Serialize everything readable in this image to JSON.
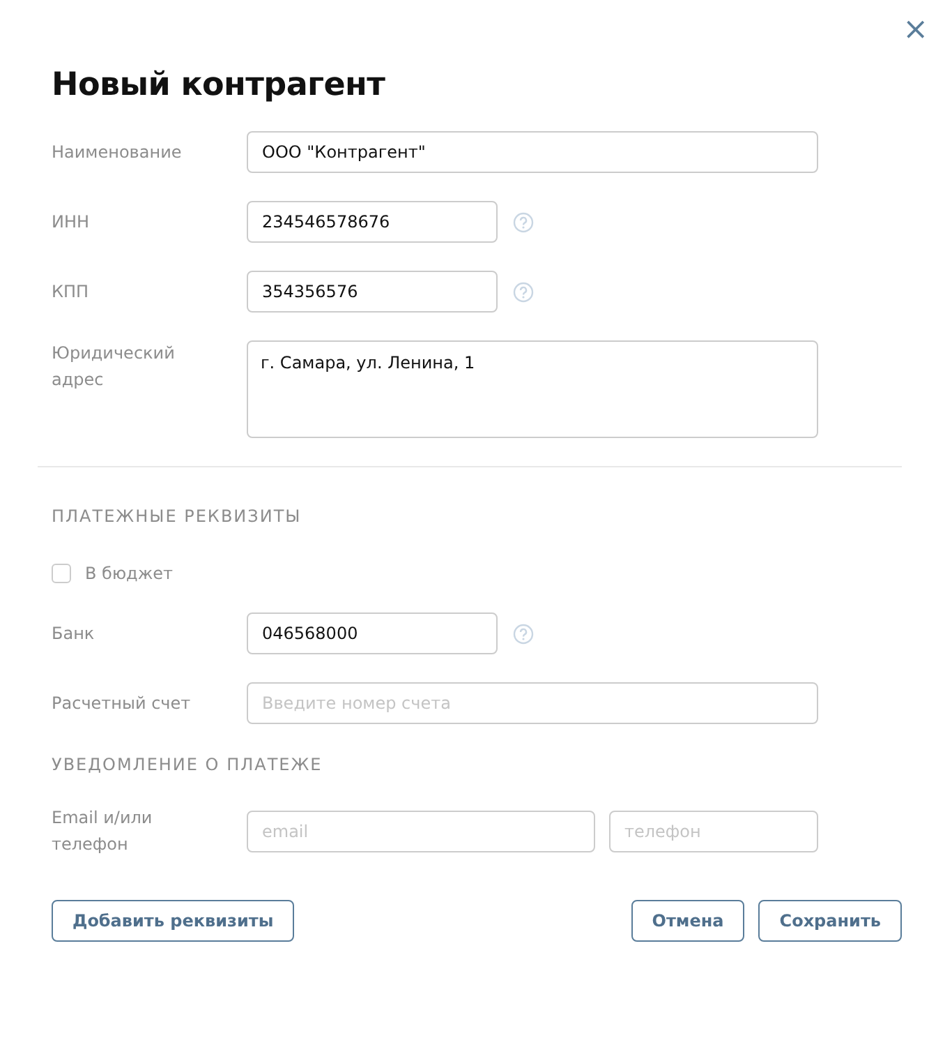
{
  "dialog": {
    "title": "Новый контрагент",
    "close": "×"
  },
  "sections": [
    {
      "fields": [
        {
          "kind": "text",
          "label": "Наименование",
          "value": "ООО \"Контрагент\"",
          "help": false
        },
        {
          "kind": "short",
          "label": "ИНН",
          "value": "234546578676",
          "help": true
        },
        {
          "kind": "short",
          "label": "КПП",
          "value": "354356576",
          "help": true
        },
        {
          "kind": "textarea",
          "label": "Юридический адрес",
          "value": "г. Самара, ул. Ленина, 1"
        }
      ]
    },
    {
      "heading": "ПЛАТЕЖНЫЕ РЕКВИЗИТЫ",
      "fields": [
        {
          "kind": "checkbox",
          "label": "В бюджет",
          "checked": false
        },
        {
          "kind": "short",
          "label": "Банк",
          "value": "046568000",
          "help": true
        },
        {
          "kind": "text",
          "label": "Расчетный счет",
          "placeholder": "Введите номер счета",
          "help": false
        }
      ]
    },
    {
      "heading": "УВЕДОМЛЕНИЕ О ПЛАТЕЖЕ",
      "fields": [
        {
          "kind": "pair",
          "label": "Email и/или телефон",
          "placeholder": "email",
          "placeholder2": "телефон"
        }
      ]
    }
  ],
  "buttons": {
    "left": "Добавить реквизиты",
    "right": [
      "Отмена",
      "Сохранить"
    ]
  }
}
